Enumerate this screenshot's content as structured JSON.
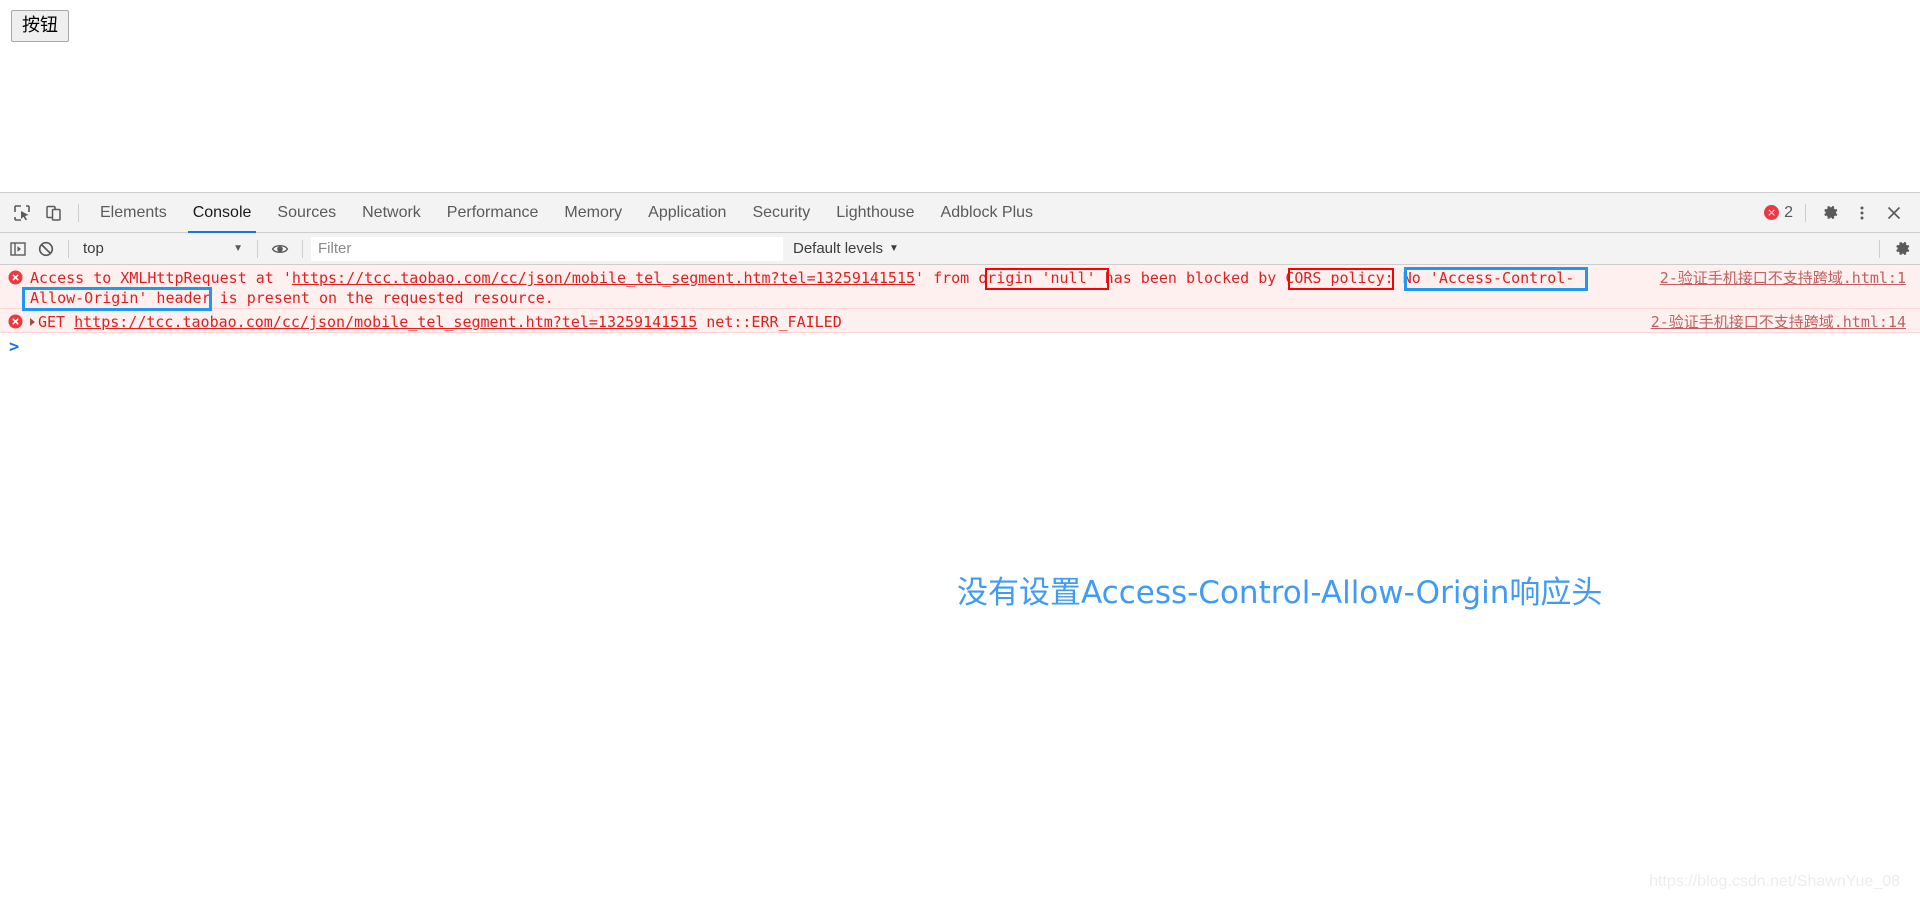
{
  "page": {
    "button_label": "按钮"
  },
  "devtools": {
    "icons": {
      "inspect": "inspect-element-icon",
      "device": "device-toolbar-icon",
      "settings": "gear-icon",
      "more": "kebab-menu-icon",
      "close": "close-icon"
    },
    "tabs": [
      {
        "label": "Elements",
        "active": false
      },
      {
        "label": "Console",
        "active": true
      },
      {
        "label": "Sources",
        "active": false
      },
      {
        "label": "Network",
        "active": false
      },
      {
        "label": "Performance",
        "active": false
      },
      {
        "label": "Memory",
        "active": false
      },
      {
        "label": "Application",
        "active": false
      },
      {
        "label": "Security",
        "active": false
      },
      {
        "label": "Lighthouse",
        "active": false
      },
      {
        "label": "Adblock Plus",
        "active": false
      }
    ],
    "error_count": "2",
    "filterbar": {
      "sidebar_toggle_icon": "show-console-sidebar-icon",
      "clear_icon": "clear-console-icon",
      "context": "top",
      "context_caret": "▼",
      "eye_icon": "live-expression-eye-icon",
      "filter_placeholder": "Filter",
      "filter_value": "",
      "levels_label": "Default levels",
      "levels_caret": "▼",
      "settings_icon": "console-settings-gear-icon"
    }
  },
  "console": {
    "messages": [
      {
        "type": "error",
        "icon": "error-circle-icon",
        "seg_1": "Access to XMLHttpRequest at '",
        "url_1": "https://tcc.taobao.com/cc/json/mobile_tel_segment.htm?tel=13259141515",
        "seg_2": "' from ",
        "hl_origin": "origin 'null'",
        "seg_3": " has been blocked by ",
        "hl_cors": "CORS policy",
        "seg_4": ": ",
        "hl_header_a": "No 'Access-Control-",
        "hl_header_b": "Allow-Origin' header",
        "seg_5": " is present on the requested resource.",
        "source": "2-验证手机接口不支持跨域.html:1"
      },
      {
        "type": "error",
        "icon": "error-circle-icon",
        "expander": "▶",
        "method": "GET",
        "url": "https://tcc.taobao.com/cc/json/mobile_tel_segment.htm?tel=13259141515",
        "status": "net::ERR_FAILED",
        "source": "2-验证手机接口不支持跨域.html:14"
      }
    ],
    "prompt": ">"
  },
  "annotation": {
    "text": "没有设置Access-Control-Allow-Origin响应头",
    "color": "#3f9bf5",
    "box_red_color": "#ff0000",
    "box_blue_color": "#2196f3"
  },
  "watermark": {
    "text": "https://blog.csdn.net/ShawnYue_08"
  }
}
